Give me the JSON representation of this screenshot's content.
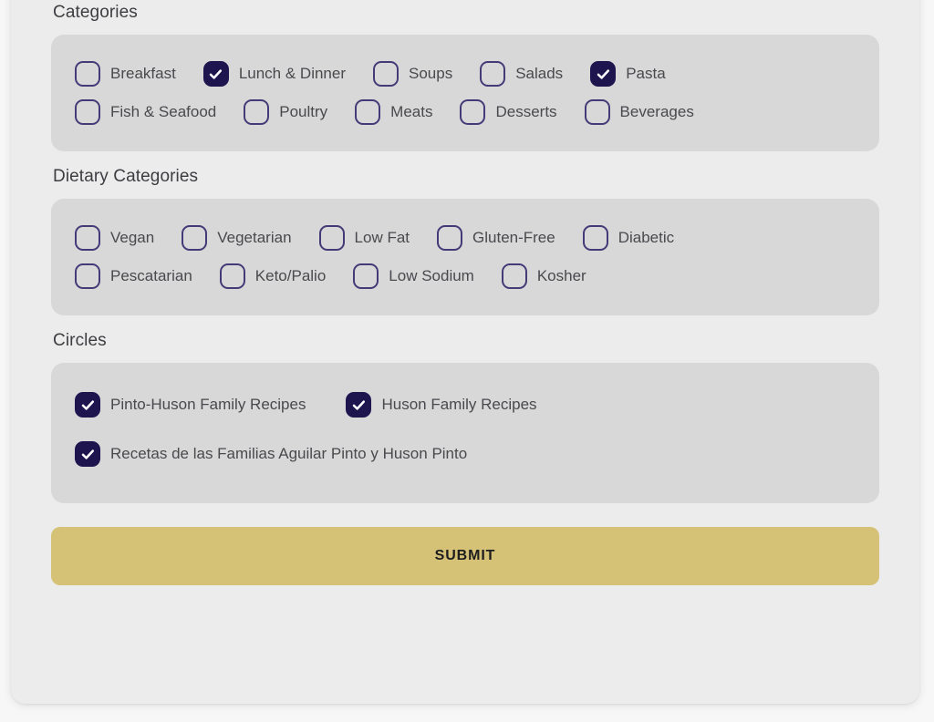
{
  "colors": {
    "page_background": "#f7f7f7",
    "card_background": "#ececec",
    "panel_background": "#d8d8d8",
    "checkbox_checked_fill": "#1e154f",
    "checkbox_unchecked_border": "#433b77",
    "checkbox_tick": "#ffffff",
    "label_text": "#49494e",
    "section_title_text": "#3d3d42",
    "submit_background": "#d5c277",
    "submit_text": "#1d1d1d"
  },
  "sections": [
    {
      "key": "categories",
      "title": "Categories",
      "rows": [
        [
          {
            "label": "Breakfast",
            "checked": false
          },
          {
            "label": "Lunch & Dinner",
            "checked": true
          },
          {
            "label": "Soups",
            "checked": false
          },
          {
            "label": "Salads",
            "checked": false
          },
          {
            "label": "Pasta",
            "checked": true
          }
        ],
        [
          {
            "label": "Fish & Seafood",
            "checked": false
          },
          {
            "label": "Poultry",
            "checked": false
          },
          {
            "label": "Meats",
            "checked": false
          },
          {
            "label": "Desserts",
            "checked": false
          },
          {
            "label": "Beverages",
            "checked": false
          }
        ]
      ]
    },
    {
      "key": "dietary_categories",
      "title": "Dietary Categories",
      "rows": [
        [
          {
            "label": "Vegan",
            "checked": false
          },
          {
            "label": "Vegetarian",
            "checked": false
          },
          {
            "label": "Low Fat",
            "checked": false
          },
          {
            "label": "Gluten-Free",
            "checked": false
          },
          {
            "label": "Diabetic",
            "checked": false
          }
        ],
        [
          {
            "label": "Pescatarian",
            "checked": false
          },
          {
            "label": "Keto/Palio",
            "checked": false
          },
          {
            "label": "Low Sodium",
            "checked": false
          },
          {
            "label": "Kosher",
            "checked": false
          }
        ]
      ]
    },
    {
      "key": "circles",
      "title": "Circles",
      "rows": [
        [
          {
            "label": "Pinto-Huson Family Recipes",
            "checked": true
          },
          {
            "label": "Huson Family Recipes",
            "checked": true
          }
        ],
        [
          {
            "label": "Recetas de las Familias Aguilar Pinto y Huson Pinto",
            "checked": true
          }
        ]
      ]
    }
  ],
  "submit": {
    "label": "SUBMIT"
  },
  "icons": {
    "check": "check-icon"
  }
}
